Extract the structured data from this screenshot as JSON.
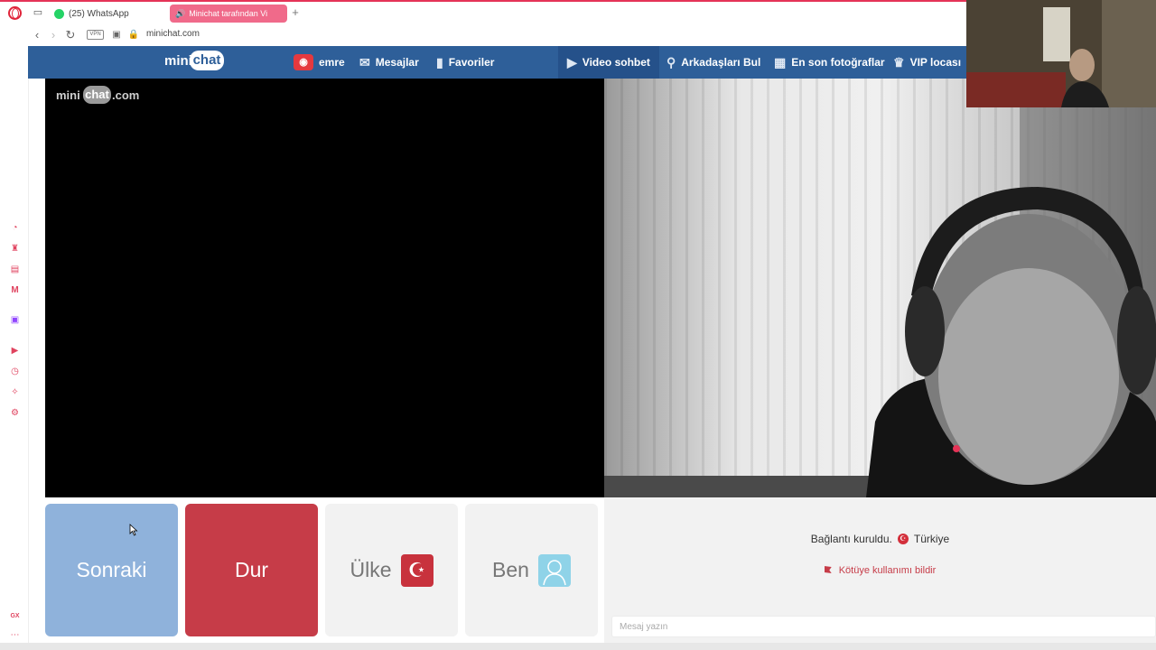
{
  "browser": {
    "tabs": [
      {
        "label": "(25) WhatsApp"
      },
      {
        "label": "Minichat tarafından Vi"
      }
    ],
    "new_tab_label": "+",
    "vpn_label": "VPN",
    "url": "minichat.com"
  },
  "site": {
    "logo_mini": "mini",
    "logo_chat": "chat",
    "nav": {
      "user": "emre",
      "messages": "Mesajlar",
      "favorites": "Favoriler",
      "video_chat": "Video sohbet",
      "find_friends": "Arkadaşları Bul",
      "latest_photos": "En son fotoğraflar",
      "vip": "VIP locası"
    },
    "watermark": {
      "mini": "mini",
      "chat": "chat",
      "com": ".com"
    }
  },
  "controls": {
    "next": "Sonraki",
    "stop": "Dur",
    "country": "Ülke",
    "me": "Ben"
  },
  "chat": {
    "status": "Bağlantı kuruldu.",
    "country": "Türkiye",
    "report": "Kötüye kullanımı bildir",
    "input_placeholder": "Mesaj yazın"
  },
  "sidebar_gx": "GX",
  "colors": {
    "header_blue": "#2e5f99",
    "next_blue": "#8fb2db",
    "stop_red": "#c63c48",
    "opera_red": "#e0243a"
  }
}
